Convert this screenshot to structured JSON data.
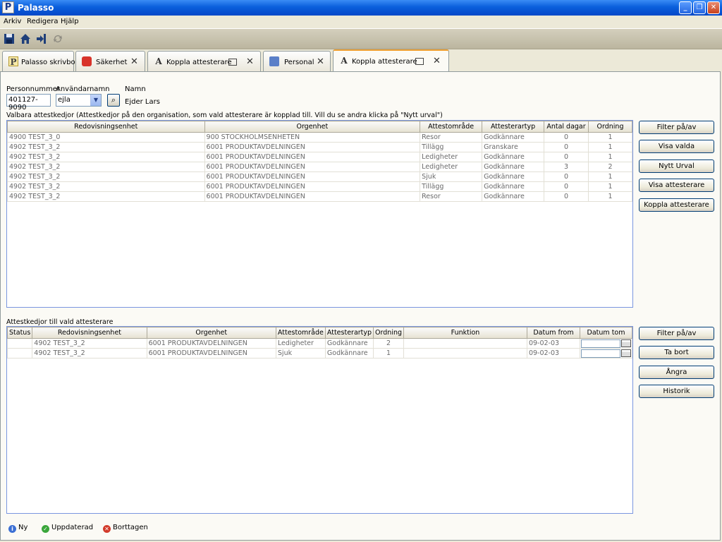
{
  "window": {
    "title": "Palasso",
    "app_icon": "P"
  },
  "menu": [
    "Arkiv",
    "Redigera",
    "Hjälp"
  ],
  "tabs": [
    {
      "label": "Palasso skrivbord",
      "icon": "P"
    },
    {
      "label": "Säkerhet",
      "icon": "shield"
    },
    {
      "label": "Koppla attesterare",
      "icon": "A"
    },
    {
      "label": "Personal",
      "icon": "person"
    },
    {
      "label": "Koppla attesterare",
      "icon": "A"
    }
  ],
  "form": {
    "personnummer_label": "Personnummer",
    "personnummer_value": "401127-9090",
    "anvandarnamn_label": "Användarnamn",
    "anvandarnamn_value": "ejla",
    "namn_label": "Namn",
    "namn_value": "Ejder Lars"
  },
  "top_grid": {
    "caption": "Valbara attestkedjor  (Attestkedjor på den organisation, som vald attesterare är kopplad till. Vill du se andra klicka på \"Nytt urval\")",
    "headers": [
      "Redovisningsenhet",
      "Orgenhet",
      "Attestområde",
      "Attesterartyp",
      "Antal dagar",
      "Ordning"
    ],
    "rows": [
      [
        "4900    TEST_3_0",
        "900 STOCKHOLMSENHETEN",
        "Resor",
        "Godkännare",
        "0",
        "1"
      ],
      [
        "4902    TEST_3_2",
        "6001 PRODUKTAVDELNINGEN",
        "Tillägg",
        "Granskare",
        "0",
        "1"
      ],
      [
        "4902    TEST_3_2",
        "6001 PRODUKTAVDELNINGEN",
        "Ledigheter",
        "Godkännare",
        "0",
        "1"
      ],
      [
        "4902    TEST_3_2",
        "6001 PRODUKTAVDELNINGEN",
        "Ledigheter",
        "Godkännare",
        "3",
        "2"
      ],
      [
        "4902    TEST_3_2",
        "6001 PRODUKTAVDELNINGEN",
        "Sjuk",
        "Godkännare",
        "0",
        "1"
      ],
      [
        "4902    TEST_3_2",
        "6001 PRODUKTAVDELNINGEN",
        "Tillägg",
        "Godkännare",
        "0",
        "1"
      ],
      [
        "4902    TEST_3_2",
        "6001 PRODUKTAVDELNINGEN",
        "Resor",
        "Godkännare",
        "0",
        "1"
      ]
    ]
  },
  "top_buttons": [
    "Filter på/av",
    "Visa valda",
    "Nytt Urval",
    "Visa attesterare",
    "Koppla attesterare"
  ],
  "bottom_grid": {
    "caption": "Attestkedjor till vald attesterare",
    "headers": [
      "Status",
      "Redovisningsenhet",
      "Orgenhet",
      "Attestområde",
      "Attesterartyp",
      "Ordning",
      "Funktion",
      "Datum from",
      "Datum tom"
    ],
    "rows": [
      [
        "",
        "4902    TEST_3_2",
        "6001 PRODUKTAVDELNINGEN",
        "Ledigheter",
        "Godkännare",
        "2",
        "",
        "09-02-03",
        ""
      ],
      [
        "",
        "4902    TEST_3_2",
        "6001 PRODUKTAVDELNINGEN",
        "Sjuk",
        "Godkännare",
        "1",
        "",
        "09-02-03",
        ""
      ]
    ]
  },
  "bottom_buttons": [
    "Filter på/av",
    "Ta bort",
    "Ångra",
    "Historik"
  ],
  "legend": [
    {
      "label": "Ny",
      "color": "#3b6fd4",
      "glyph": "i"
    },
    {
      "label": "Uppdaterad",
      "color": "#3aa63a",
      "glyph": "✓"
    },
    {
      "label": "Borttagen",
      "color": "#d23a2a",
      "glyph": "✕"
    }
  ]
}
